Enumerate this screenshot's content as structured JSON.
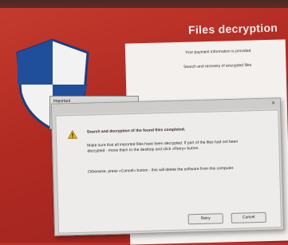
{
  "window": {
    "title": "Files decryption",
    "info_line1": "Your payment information is provided",
    "info_line2": "Search and recovery of encrypted files"
  },
  "small_dialog": {
    "title": "Important"
  },
  "dialog": {
    "close_label": "×",
    "message1": "Search and decryption of the found files completed.",
    "message2": "Make sure that all imported files have been decrypted. If part of the files had not been decrypted - move them to the desktop and click «Retry» button.",
    "message3": "Otherwise, press «Cancel» button - this will delete the software from this computer.",
    "retry_label": "Retry",
    "cancel_label": "Cancel"
  },
  "colors": {
    "background_red": "#b8322a",
    "shield_blue": "#1f4f9a",
    "shield_white": "#f2f2f2",
    "warning_yellow": "#e8b020"
  },
  "icons": [
    "shield-logo-icon",
    "warning-icon",
    "close-icon"
  ]
}
